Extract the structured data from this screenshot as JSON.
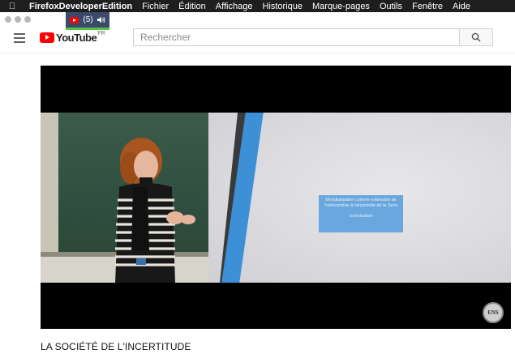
{
  "menubar": {
    "app_name": "FirefoxDeveloperEdition",
    "items": [
      "Fichier",
      "Édition",
      "Affichage",
      "Historique",
      "Marque-pages",
      "Outils",
      "Fenêtre",
      "Aide"
    ]
  },
  "tab": {
    "count_label": "(5)"
  },
  "header": {
    "logo_text": "YouTube",
    "region": "FR",
    "search_placeholder": "Rechercher"
  },
  "player": {
    "slide_text": "Mondialisation comme extension de l'oekoumène à l'ensemble de la Terre",
    "slide_subtext": "colonisation",
    "watermark": "ENS"
  },
  "video": {
    "title": "LA SOCIÉTÉ DE L'INCERTITUDE"
  },
  "colors": {
    "brand_red": "#ff0000",
    "accent_blue": "#3d8fd6",
    "menubar_bg": "#1e1e1e"
  }
}
